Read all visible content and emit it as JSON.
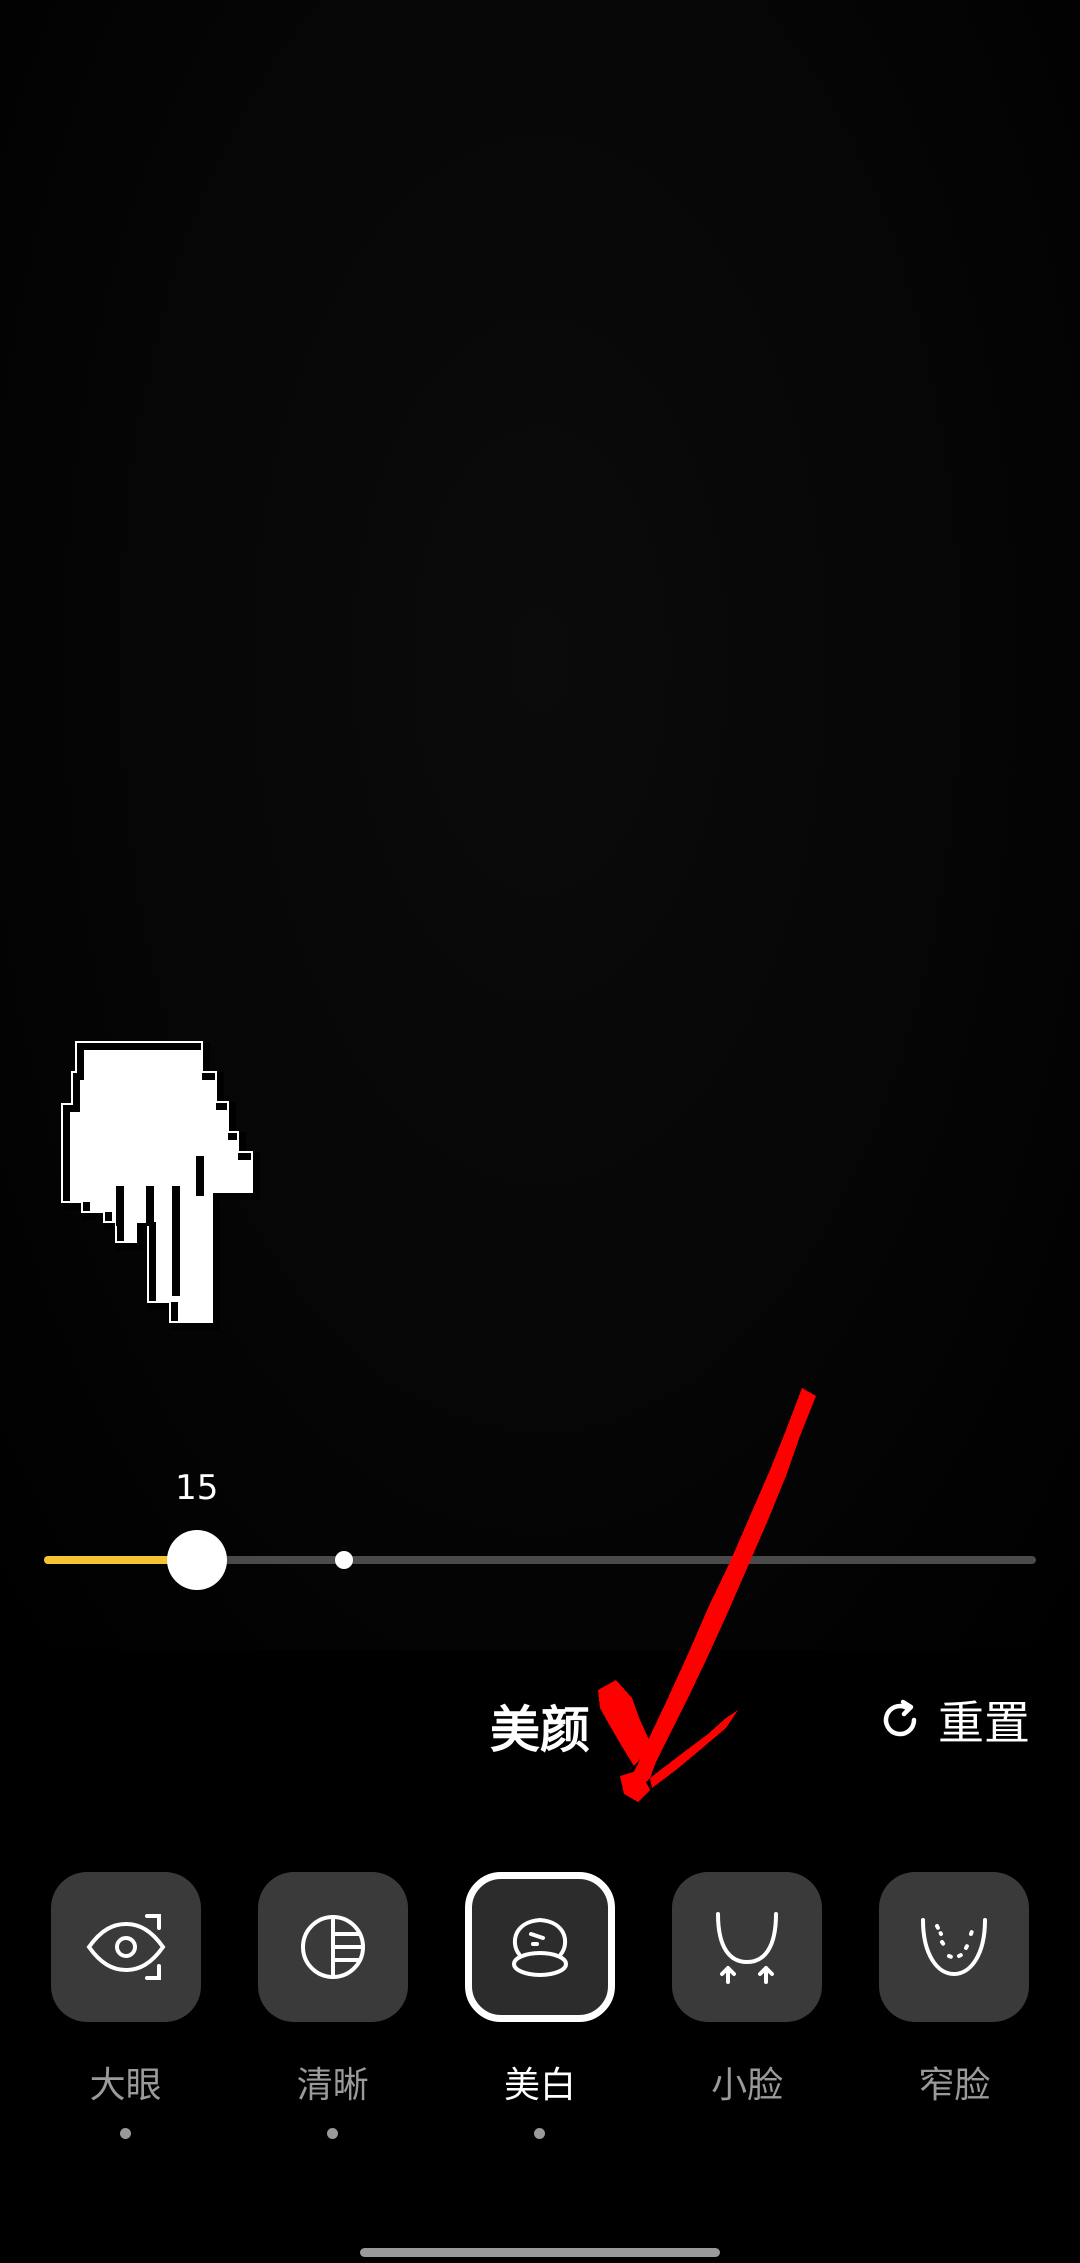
{
  "preview": {
    "description_icon": "camera-preview"
  },
  "slider": {
    "value_label": "15",
    "value_fraction": 0.154,
    "default_fraction": 0.302,
    "fill_color": "#f6c431",
    "track_color": "#4a4a4a"
  },
  "panel": {
    "title": "美颜",
    "reset_label": "重置",
    "reset_icon": "refresh-icon"
  },
  "tools": [
    {
      "label": "大眼",
      "icon": "eye-scan-icon",
      "selected": false,
      "has_dot": true
    },
    {
      "label": "清晰",
      "icon": "half-circle-lines-icon",
      "selected": false,
      "has_dot": true
    },
    {
      "label": "美白",
      "icon": "whiten-face-icon",
      "selected": true,
      "has_dot": true
    },
    {
      "label": "小脸",
      "icon": "slim-face-arrows-icon",
      "selected": false,
      "has_dot": false
    },
    {
      "label": "窄脸",
      "icon": "narrow-face-icon",
      "selected": false,
      "has_dot": false
    }
  ],
  "colors": {
    "accent": "#f6c431",
    "annotation_red": "#ff0000",
    "tool_bg": "#3a3a3a",
    "label_inactive": "#9a9a9a"
  }
}
